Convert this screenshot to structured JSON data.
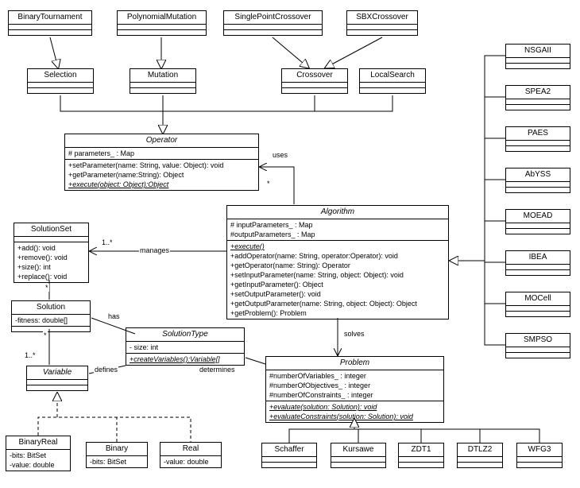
{
  "classes": {
    "BinaryTournament": {
      "title": "BinaryTournament"
    },
    "PolynomialMutation": {
      "title": "PolynomialMutation"
    },
    "SinglePointCrossover": {
      "title": "SinglePointCrossover"
    },
    "SBXCrossover": {
      "title": "SBXCrossover"
    },
    "Selection": {
      "title": "Selection"
    },
    "Mutation": {
      "title": "Mutation"
    },
    "Crossover": {
      "title": "Crossover"
    },
    "LocalSearch": {
      "title": "LocalSearch"
    },
    "Operator": {
      "title": "Operator",
      "attrs": [
        "# parameters_ : Map"
      ],
      "ops": [
        "+setParameter(name: String, value: Object): void",
        "+getParameter(name:String): Object",
        "+execute(object: Object):Object"
      ]
    },
    "Algorithm": {
      "title": "Algorithm",
      "attrs": [
        "# inputParameters_ : Map",
        "#outputParameters_ : Map"
      ],
      "ops": [
        "+execute()",
        "+addOperator(name: String, operator:Operator): void",
        "+getOperator(name: String): Operator",
        "+setInputParameter(name: String, object: Object): void",
        "+getInputParameter(): Object",
        "+setOutputParameter(): void",
        "+getOutputParameter(name: String, object: Object): Object",
        "+getProblem(): Problem"
      ]
    },
    "SolutionSet": {
      "title": "SolutionSet",
      "ops": [
        "+add(): void",
        "+remove(): void",
        "+size(): int",
        "+replace(): void"
      ]
    },
    "Solution": {
      "title": "Solution",
      "attrs": [
        "-fitness: double[]"
      ]
    },
    "SolutionType": {
      "title": "SolutionType",
      "attrs": [
        "- size: int"
      ],
      "ops": [
        "+createVariables():Variable[]"
      ]
    },
    "Variable": {
      "title": "Variable"
    },
    "Problem": {
      "title": "Problem",
      "attrs": [
        "#numberOfVariables_ : integer",
        "#numberOfObjectives_ : integer",
        "#numberOfConstraints_ : integer"
      ],
      "ops": [
        "+evaluate(solution: Solution): void",
        "+evaluateConstraints(solution: Solution): void"
      ]
    },
    "BinaryReal": {
      "title": "BinaryReal",
      "attrs": [
        "-bits: BitSet",
        "-value: double"
      ]
    },
    "Binary": {
      "title": "Binary",
      "attrs": [
        "-bits: BitSet"
      ]
    },
    "Real": {
      "title": "Real",
      "attrs": [
        "-value: double"
      ]
    },
    "Schaffer": {
      "title": "Schaffer"
    },
    "Kursawe": {
      "title": "Kursawe"
    },
    "ZDT1": {
      "title": "ZDT1"
    },
    "DTLZ2": {
      "title": "DTLZ2"
    },
    "WFG3": {
      "title": "WFG3"
    },
    "NSGAII": {
      "title": "NSGAII"
    },
    "SPEA2": {
      "title": "SPEA2"
    },
    "PAES": {
      "title": "PAES"
    },
    "AbYSS": {
      "title": "AbYSS"
    },
    "MOEAD": {
      "title": "MOEAD"
    },
    "IBEA": {
      "title": "IBEA"
    },
    "MOCell": {
      "title": "MOCell"
    },
    "SMPSO": {
      "title": "SMPSO"
    }
  },
  "labels": {
    "uses": "uses",
    "manages": "manages",
    "has": "has",
    "defines": "defines",
    "determines": "determines",
    "solves": "solves",
    "star1": "*",
    "star2": "*",
    "star3": "*",
    "one_many1": "1..*",
    "one_many2": "1..*"
  }
}
